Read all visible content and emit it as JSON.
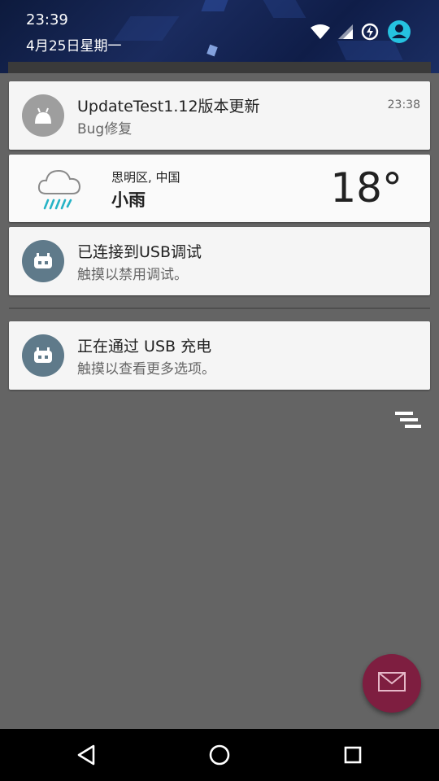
{
  "status": {
    "time": "23:39",
    "date": "4月25日星期一"
  },
  "notifications": [
    {
      "title": "UpdateTest1.12版本更新",
      "subtitle": "Bug修复",
      "time": "23:38",
      "icon": "android-icon"
    },
    {
      "title": "已连接到USB调试",
      "subtitle": "触摸以禁用调试。",
      "icon": "cyanogen-bot-icon"
    },
    {
      "title": "正在通过 USB 充电",
      "subtitle": "触摸以查看更多选项。",
      "icon": "cyanogen-bot-icon"
    }
  ],
  "weather": {
    "location": "思明区, 中国",
    "condition": "小雨",
    "temperature": "18°",
    "icon": "rain-cloud-icon"
  },
  "colors": {
    "background": "#646464",
    "card": "#f5f5f5",
    "fab": "#7e1e40",
    "avatar_grey": "#9e9e9e",
    "avatar_slate": "#5f7a8a",
    "rain": "#26b3c6"
  },
  "fab": {
    "icon": "mail-icon"
  },
  "navbar": {
    "icons": [
      "back-icon",
      "home-icon",
      "recents-icon"
    ]
  }
}
